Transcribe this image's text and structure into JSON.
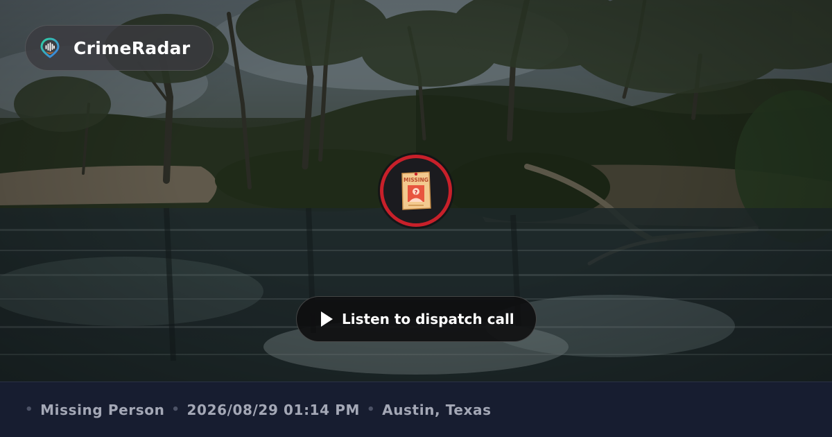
{
  "brand": {
    "name": "CrimeRadar",
    "logo_icon": "radar-pin-icon"
  },
  "incident_badge": {
    "icon": "missing-poster-icon",
    "poster_text": "MISSING",
    "ring_color": "#c8202a"
  },
  "player": {
    "label": "Listen to dispatch call",
    "icon": "play-icon"
  },
  "meta": {
    "separator": "•",
    "category": "Missing Person",
    "datetime": "2026/08/29 01:14 PM",
    "location": "Austin, Texas"
  },
  "colors": {
    "footer_bg": "#171d30",
    "footer_text": "#a4a8b6",
    "accent_red": "#c8202a"
  }
}
